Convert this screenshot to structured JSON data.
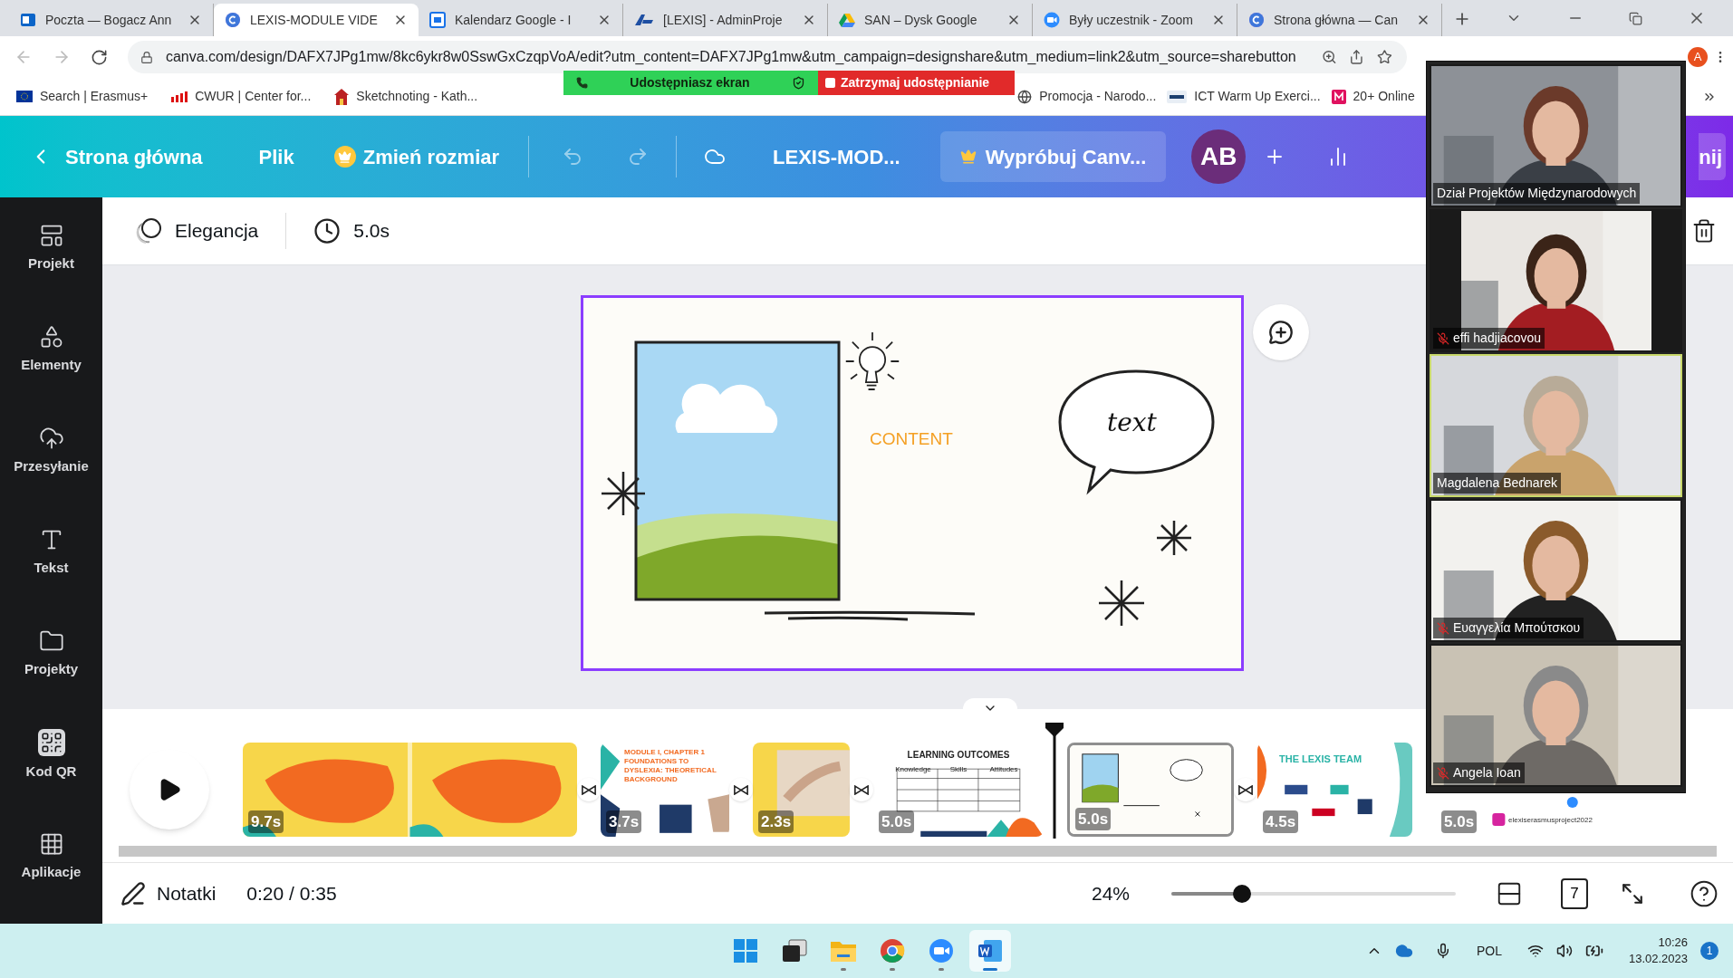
{
  "browser": {
    "tabs": [
      {
        "title": "Poczta — Bogacz Ann",
        "selected": false
      },
      {
        "title": "LEXIS-MODULE VIDE",
        "selected": true
      },
      {
        "title": "Kalendarz Google - I",
        "selected": false
      },
      {
        "title": "[LEXIS] - AdminProje",
        "selected": false
      },
      {
        "title": "SAN – Dysk Google",
        "selected": false
      },
      {
        "title": "Były uczestnik - Zoom",
        "selected": false
      },
      {
        "title": "Strona główna — Can",
        "selected": false
      }
    ],
    "url": "canva.com/design/DAFX7JPg1mw/8kc6ykr8w0SswGxCzqpVoA/edit?utm_content=DAFX7JPg1mw&utm_campaign=designshare&utm_medium=link2&utm_source=sharebutton",
    "profile": "A",
    "bookmarks_left": [
      "Search | Erasmus+",
      "CWUR | Center for...",
      "Sketchnoting - Kath..."
    ],
    "bookmarks_right": [
      "Promocja - Narodo...",
      "ICT Warm Up Exerci...",
      "20+ Online"
    ]
  },
  "share_bar": {
    "status": "Udostępniasz ekran",
    "stop": "Zatrzymaj udostępnianie"
  },
  "header": {
    "home": "Strona główna",
    "file": "Plik",
    "resize": "Zmień rozmiar",
    "title": "LEXIS-MOD...",
    "trial": "Wypróbuj Canv...",
    "avatar": "AB",
    "share_partial": "nij"
  },
  "sidebar": [
    "Projekt",
    "Elementy",
    "Przesyłanie",
    "Tekst",
    "Projekty",
    "Kod QR",
    "Aplikacje"
  ],
  "toolbar": {
    "animation": "Elegancja",
    "duration": "5.0s"
  },
  "slide": {
    "heading": "CONTENT",
    "bubble": "text"
  },
  "timeline": {
    "pages": [
      {
        "kind": "orange",
        "duration": "9.7s",
        "selected": false,
        "transition_after": true
      },
      {
        "kind": "module",
        "duration": "3.7s",
        "title": "MODULE I, CHAPTER 1",
        "subtitle": "FOUNDATIONS TO DYSLEXIA: THEORETICAL BACKGROUND",
        "selected": false,
        "transition_after": true
      },
      {
        "duration": "2.3s",
        "selected": false,
        "transition_after": true
      },
      {
        "kind": "table",
        "duration": "5.0s",
        "title": "LEARNING OUTCOMES",
        "columns": [
          "Knowledge",
          "Skills",
          "Attitudes"
        ],
        "selected": false,
        "transition_after": false
      },
      {
        "kind": "content",
        "duration": "5.0s",
        "selected": true,
        "transition_after": true
      },
      {
        "kind": "team",
        "duration": "4.5s",
        "title": "THE LEXIS TEAM",
        "selected": false,
        "transition_after": false
      },
      {
        "kind": "social",
        "duration": "5.0s",
        "title": "elexiserasmusproject2022",
        "selected": false,
        "transition_after": false
      }
    ]
  },
  "bottom": {
    "notes": "Notatki",
    "time": "0:20 / 0:35",
    "zoom": "24%",
    "zoom_slider": {
      "level": 0.23
    },
    "page_count": "7"
  },
  "zoom_panel": {
    "participants": [
      {
        "name": "Dział Projektów Międzynarodowych",
        "muted": false,
        "speaking": false,
        "letterboxed": false
      },
      {
        "name": "effi hadjiacovou",
        "muted": true,
        "speaking": false,
        "letterboxed": true
      },
      {
        "name": "Magdalena Bednarek",
        "muted": false,
        "speaking": true,
        "letterboxed": false
      },
      {
        "name": "Ευαγγελία Μπούτσκου",
        "muted": true,
        "speaking": false,
        "letterboxed": false
      },
      {
        "name": "Angela Ioan",
        "muted": true,
        "speaking": false,
        "letterboxed": false
      }
    ]
  },
  "taskbar": {
    "apps": [
      {
        "kind": "start",
        "running": false,
        "active": false
      },
      {
        "kind": "taskview",
        "running": false,
        "active": false
      },
      {
        "kind": "explorer",
        "running": true,
        "active": false
      },
      {
        "kind": "chrome",
        "running": true,
        "active": false
      },
      {
        "kind": "zoom",
        "running": true,
        "active": false
      },
      {
        "kind": "word",
        "running": true,
        "active": true
      }
    ],
    "language": "POL",
    "time": "10:26",
    "date": "13.02.2023",
    "notifications": "1"
  }
}
